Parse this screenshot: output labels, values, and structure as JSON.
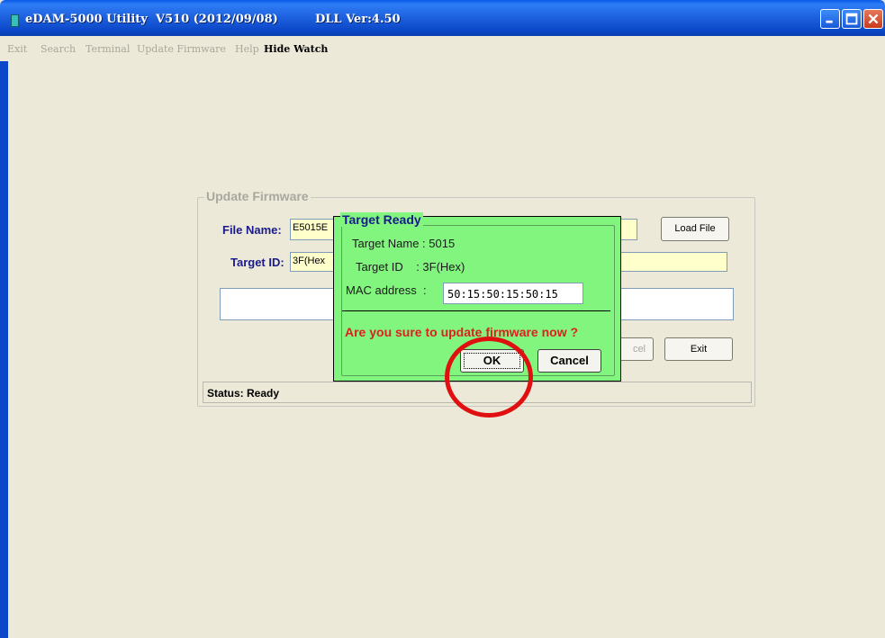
{
  "window": {
    "title": "eDAM-5000 Utility  V510 (2012/09/08)",
    "dll_version": "DLL Ver:4.50",
    "title_bar_color": "#0b47c8"
  },
  "menu": {
    "items": [
      {
        "label": "Exit",
        "enabled": false
      },
      {
        "label": "Search",
        "enabled": false
      },
      {
        "label": "Terminal",
        "enabled": false
      },
      {
        "label": "Update Firmware",
        "enabled": false
      },
      {
        "label": "Help",
        "enabled": false
      },
      {
        "label": "Hide Watch",
        "enabled": true
      }
    ]
  },
  "update_firmware": {
    "legend": "Update Firmware",
    "file_name_label": "File Name:",
    "file_name_value": "E5015E",
    "load_file_button": "Load File",
    "target_id_label": "Target ID:",
    "target_id_value": "3F(Hex",
    "cancel_button": "cel",
    "exit_button": "Exit",
    "status": "Status: Ready"
  },
  "dialog": {
    "title": "Target Ready",
    "target_name": "Target Name : 5015",
    "target_id": "Target ID    : 3F(Hex)",
    "mac_label": "MAC address  :",
    "mac_value": "50:15:50:15:50:15",
    "question": "Are you sure to update firmware now ?",
    "ok_button": "OK",
    "cancel_button": "Cancel",
    "background_color": "#82f57e",
    "question_color": "#dd2020"
  },
  "highlight": {
    "color": "#e01010",
    "target": "ok-button"
  }
}
